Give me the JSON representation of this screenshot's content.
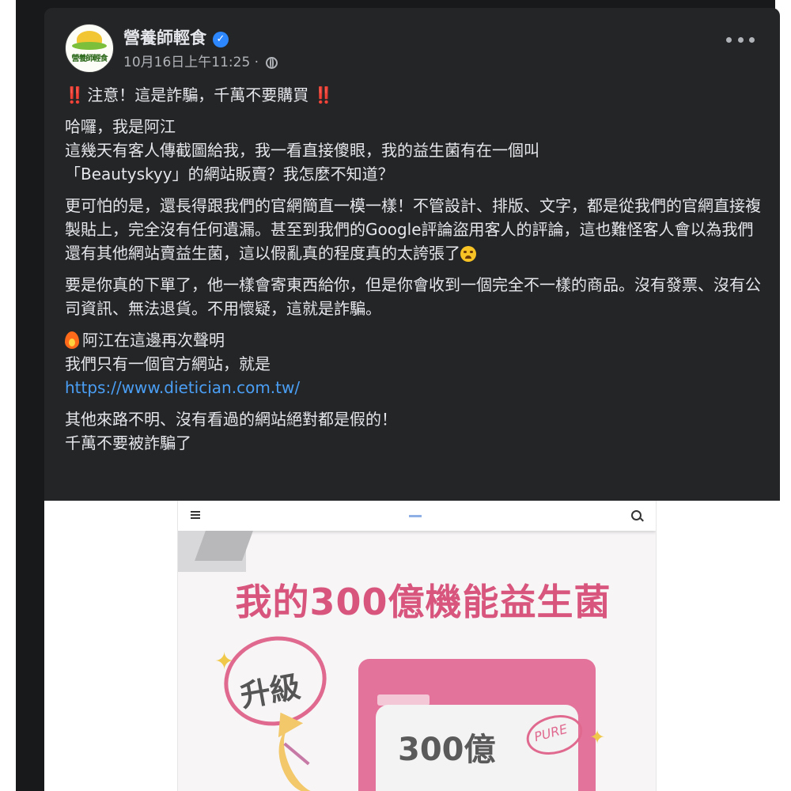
{
  "page": {
    "name": "營養師輕食",
    "avatar_text": "營養師輕食",
    "timestamp": "10月16日上午11:25 ·"
  },
  "post": {
    "line1_alert": "‼️",
    "line1_text": "注意！這是詐騙，千萬不要購買",
    "line1_alert_end": "‼️",
    "para2_line1": "哈囉，我是阿江",
    "para2_line2": "這幾天有客人傳截圖給我，我一看直接傻眼，我的益生菌有在一個叫",
    "para2_line3": "「Beautyskyy」的網站販賣？我怎麼不知道？",
    "para3_text": "更可怕的是，還長得跟我們的官網簡直一模一樣！不管設計、排版、文字，都是從我們的官網直接複製貼上，完全沒有任何遺漏。甚至到我們的Google評論盜用客人的評論，這也難怪客人會以為我們還有其他網站賣益生菌，這以假亂真的程度真的太誇張了",
    "para4_text": "要是你真的下單了，他一樣會寄東西給你，但是你會收到一個完全不一樣的商品。沒有發票、沒有公司資訊、無法退貨。不用懷疑，這就是詐騙。",
    "para5_line1": "阿江在這邊再次聲明",
    "para5_line2": "我們只有一個官方網站，就是",
    "para5_link": "https://www.dietician.com.tw/",
    "para6_line1": "其他來路不明、沒有看過的網站絕對都是假的！",
    "para6_line2": "千萬不要被詐騙了"
  },
  "image": {
    "headline": "我的300億機能益生菌",
    "badge": "升級",
    "package_number": "300億",
    "pure_label": "PURE"
  },
  "icons": {
    "verified": "verified-badge-icon",
    "globe": "globe-icon",
    "more": "more-options-icon",
    "fire": "fire-icon",
    "emoji": "steaming-face-icon",
    "hamburger": "hamburger-menu-icon",
    "search": "search-icon"
  },
  "colors": {
    "background": "#242526",
    "text": "#e4e6eb",
    "secondary_text": "#b0b3b8",
    "link": "#4a9ff5",
    "verified": "#2d88ff",
    "alert": "#f02849",
    "promo_pink": "#d8567e"
  }
}
